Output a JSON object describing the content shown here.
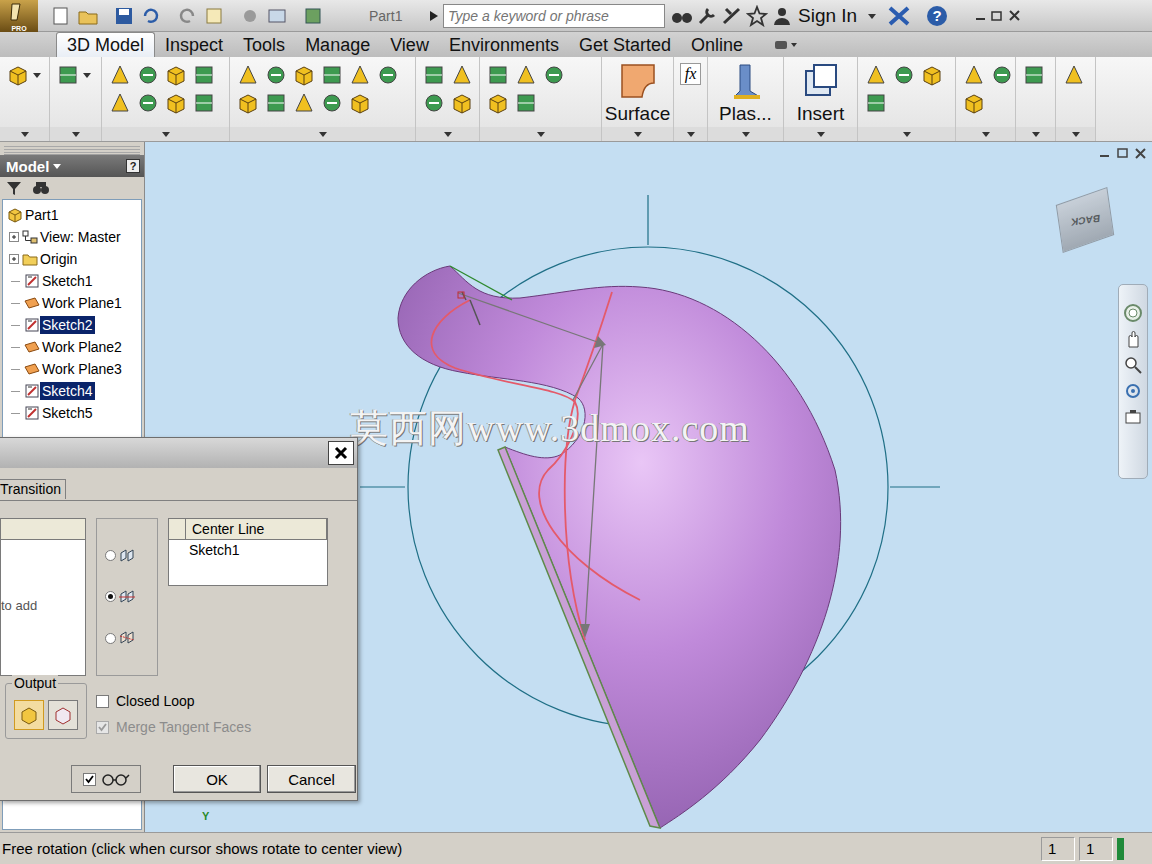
{
  "titlebar": {
    "badge": "PRO",
    "document": "Part1",
    "search_placeholder": "Type a keyword or phrase",
    "sign_in": "Sign In",
    "help": "?"
  },
  "tabs": [
    {
      "label": "3D Model",
      "selected": true
    },
    {
      "label": "Inspect",
      "selected": false
    },
    {
      "label": "Tools",
      "selected": false
    },
    {
      "label": "Manage",
      "selected": false
    },
    {
      "label": "View",
      "selected": false
    },
    {
      "label": "Environments",
      "selected": false
    },
    {
      "label": "Get Started",
      "selected": false
    },
    {
      "label": "Online",
      "selected": false
    }
  ],
  "ribbon": {
    "formula": "fx",
    "large_buttons": [
      {
        "label": "Surface"
      },
      {
        "label": "Plas..."
      },
      {
        "label": "Insert"
      }
    ]
  },
  "browser": {
    "title": "Model",
    "help": "?",
    "items": [
      {
        "label": "Part1",
        "kind": "part",
        "selected": false
      },
      {
        "label": "View: Master",
        "kind": "view",
        "selected": false
      },
      {
        "label": "Origin",
        "kind": "folder",
        "selected": false
      },
      {
        "label": "Sketch1",
        "kind": "sketch",
        "selected": false
      },
      {
        "label": "Work Plane1",
        "kind": "plane",
        "selected": false
      },
      {
        "label": "Sketch2",
        "kind": "sketch",
        "selected": true
      },
      {
        "label": "Work Plane2",
        "kind": "plane",
        "selected": false
      },
      {
        "label": "Work Plane3",
        "kind": "plane",
        "selected": false
      },
      {
        "label": "Sketch4",
        "kind": "sketch",
        "selected": true
      },
      {
        "label": "Sketch5",
        "kind": "sketch",
        "selected": false
      }
    ]
  },
  "viewport": {
    "view_cube": "BACK",
    "axis_label": "Y"
  },
  "dialog": {
    "tab": "Transition",
    "profiles_hint": "to add",
    "modes": [
      {
        "selected": false
      },
      {
        "selected": true
      },
      {
        "selected": false
      }
    ],
    "center_line": {
      "header": "Center Line",
      "items": [
        "Sketch1"
      ]
    },
    "output": {
      "label": "Output",
      "buttons": [
        {
          "selected": true
        },
        {
          "selected": false
        }
      ]
    },
    "closed_loop": {
      "label": "Closed Loop",
      "checked": false,
      "disabled": false
    },
    "merge_tangent": {
      "label": "Merge Tangent Faces",
      "checked": true,
      "disabled": true
    },
    "preview": {
      "checked": true
    },
    "buttons": [
      "OK",
      "Cancel"
    ]
  },
  "watermark": "莫西网www.3dmox.com",
  "status_bar": {
    "message": "Free rotation (click when cursor shows rotate to center view)",
    "cells": [
      "1",
      "1"
    ]
  }
}
